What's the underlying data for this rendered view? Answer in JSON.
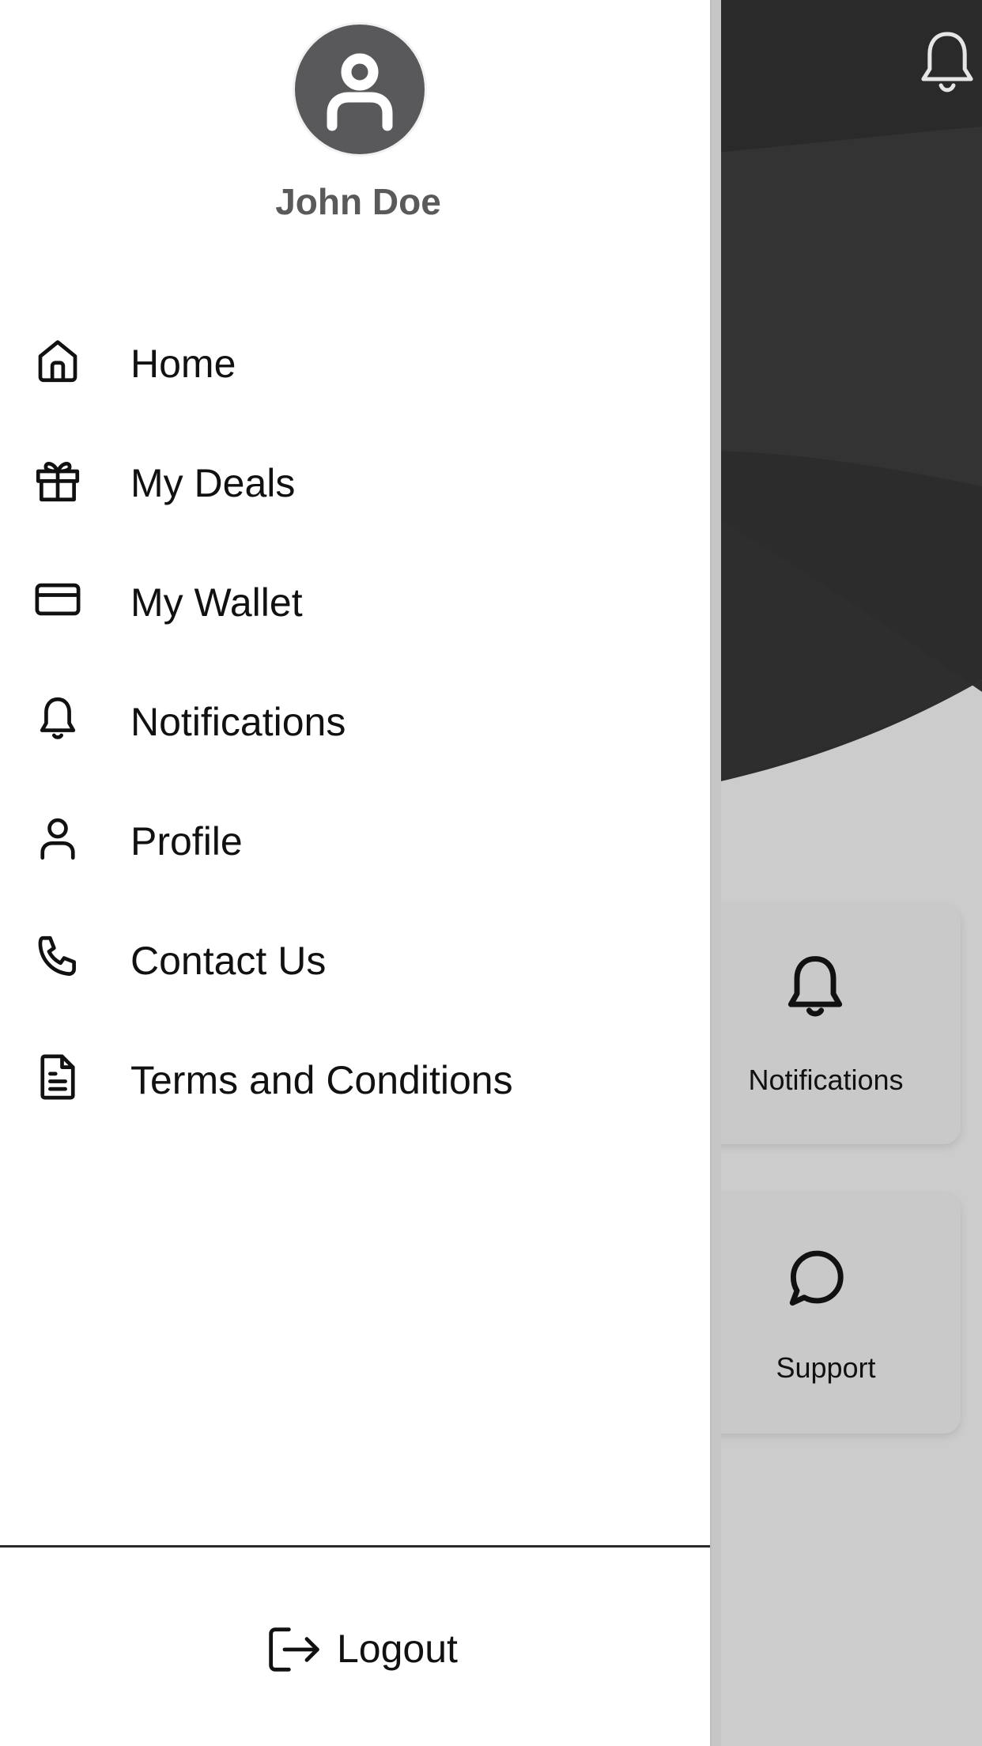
{
  "user": {
    "name": "John Doe"
  },
  "menu": {
    "items": [
      {
        "label": "Home",
        "icon": "home-icon"
      },
      {
        "label": "My Deals",
        "icon": "gift-icon"
      },
      {
        "label": "My Wallet",
        "icon": "card-icon"
      },
      {
        "label": "Notifications",
        "icon": "bell-icon"
      },
      {
        "label": "Profile",
        "icon": "user-icon"
      },
      {
        "label": "Contact Us",
        "icon": "phone-icon"
      },
      {
        "label": "Terms and Conditions",
        "icon": "document-icon"
      }
    ]
  },
  "logout": {
    "label": "Logout",
    "icon": "logout-icon"
  },
  "background": {
    "cards": [
      {
        "label": "Notifications",
        "icon": "bell-icon"
      },
      {
        "label": "Support",
        "icon": "chat-icon"
      }
    ]
  },
  "colors": {
    "drawer_bg": "#ffffff",
    "avatar_bg": "#59595c",
    "username": "#5a5a5a",
    "hero_dark": "#2c2c2c",
    "backdrop": "#cccccc"
  }
}
